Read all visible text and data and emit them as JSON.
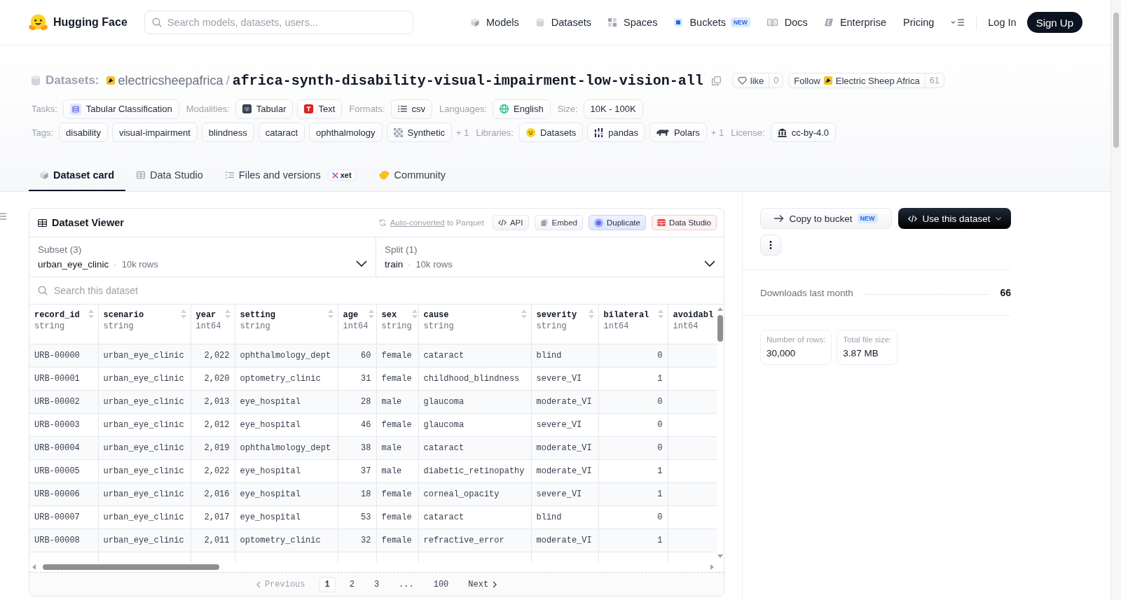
{
  "header": {
    "brand": "Hugging Face",
    "search": {
      "placeholder": "Search models, datasets, users..."
    },
    "nav": [
      {
        "label": "Models"
      },
      {
        "label": "Datasets"
      },
      {
        "label": "Spaces"
      },
      {
        "label": "Buckets",
        "badge": "NEW"
      },
      {
        "label": "Docs"
      },
      {
        "label": "Enterprise"
      },
      {
        "label": "Pricing"
      }
    ],
    "login": "Log In",
    "signup": "Sign Up"
  },
  "repo": {
    "type_label": "Datasets:",
    "owner": "electricsheepafrica",
    "separator": "/",
    "name": "africa-synth-disability-visual-impairment-low-vision-all",
    "like": {
      "label": "like",
      "count": "0"
    },
    "follow": {
      "label": "Follow",
      "org": "Electric Sheep Africa",
      "count": "61"
    }
  },
  "facet_rows": [
    [
      {
        "label": "Tasks:",
        "chips": [
          {
            "text": "Tabular Classification"
          }
        ]
      },
      {
        "label": "Modalities:",
        "chips": [
          {
            "text": "Tabular"
          },
          {
            "text": "Text"
          }
        ]
      },
      {
        "label": "Formats:",
        "chips": [
          {
            "text": "csv"
          }
        ]
      },
      {
        "label": "Languages:",
        "chips": [
          {
            "text": "English"
          }
        ]
      },
      {
        "label": "Size:",
        "chips": [
          {
            "text": "10K - 100K"
          }
        ]
      }
    ],
    [
      {
        "label": "Tags:",
        "chips": [
          {
            "text": "disability"
          },
          {
            "text": "visual-impairment"
          },
          {
            "text": "blindness"
          },
          {
            "text": "cataract"
          },
          {
            "text": "ophthalmology"
          },
          {
            "text": "Synthetic"
          }
        ],
        "more": "+ 1"
      },
      {
        "label": "Libraries:",
        "chips": [
          {
            "text": "Datasets"
          },
          {
            "text": "pandas"
          },
          {
            "text": "Polars"
          }
        ],
        "more": "+ 1"
      },
      {
        "label": "License:",
        "chips": [
          {
            "text": "cc-by-4.0"
          }
        ]
      }
    ]
  ],
  "tabs": [
    {
      "label": "Dataset card",
      "selected": true
    },
    {
      "label": "Data Studio",
      "selected": false
    },
    {
      "label": "Files and versions",
      "selected": false,
      "badge": "xet"
    },
    {
      "label": "Community",
      "selected": false
    }
  ],
  "viewer": {
    "title": "Dataset Viewer",
    "conversion": {
      "link": "Auto-converted",
      "text": "to Parquet"
    },
    "actions": [
      {
        "label": "API",
        "kind": "api"
      },
      {
        "label": "Embed",
        "kind": "embed"
      },
      {
        "label": "Duplicate",
        "kind": "duplicate"
      },
      {
        "label": "Data Studio",
        "kind": "studio"
      }
    ],
    "selectors": [
      {
        "label": "Subset (3)",
        "value": "urban_eye_clinic",
        "separator": "·",
        "count": "10k rows"
      },
      {
        "label": "Split (1)",
        "value": "train",
        "separator": "·",
        "count": "10k rows"
      }
    ],
    "search": {
      "placeholder": "Search this dataset"
    },
    "table": {
      "columns": [
        {
          "name": "record_id",
          "type": "string",
          "kind": "text"
        },
        {
          "name": "scenario",
          "type": "string",
          "kind": "text"
        },
        {
          "name": "year",
          "type": "int64",
          "kind": "number"
        },
        {
          "name": "setting",
          "type": "string",
          "kind": "text"
        },
        {
          "name": "age",
          "type": "int64",
          "kind": "number"
        },
        {
          "name": "sex",
          "type": "string",
          "kind": "text"
        },
        {
          "name": "cause",
          "type": "string",
          "kind": "text"
        },
        {
          "name": "severity",
          "type": "string",
          "kind": "text"
        },
        {
          "name": "bilateral",
          "type": "int64",
          "kind": "number"
        },
        {
          "name": "avoidabl",
          "type": "int64"
        }
      ],
      "rows": [
        [
          "URB-00000",
          "urban_eye_clinic",
          "2,022",
          "ophthalmology_dept",
          "60",
          "female",
          "cataract",
          "blind",
          "0"
        ],
        [
          "URB-00001",
          "urban_eye_clinic",
          "2,020",
          "optometry_clinic",
          "31",
          "female",
          "childhood_blindness",
          "severe_VI",
          "1"
        ],
        [
          "URB-00002",
          "urban_eye_clinic",
          "2,013",
          "eye_hospital",
          "28",
          "male",
          "glaucoma",
          "moderate_VI",
          "0"
        ],
        [
          "URB-00003",
          "urban_eye_clinic",
          "2,012",
          "eye_hospital",
          "46",
          "female",
          "glaucoma",
          "severe_VI",
          "0"
        ],
        [
          "URB-00004",
          "urban_eye_clinic",
          "2,019",
          "ophthalmology_dept",
          "38",
          "male",
          "cataract",
          "moderate_VI",
          "0"
        ],
        [
          "URB-00005",
          "urban_eye_clinic",
          "2,022",
          "eye_hospital",
          "37",
          "male",
          "diabetic_retinopathy",
          "moderate_VI",
          "1"
        ],
        [
          "URB-00006",
          "urban_eye_clinic",
          "2,016",
          "eye_hospital",
          "18",
          "female",
          "corneal_opacity",
          "severe_VI",
          "1"
        ],
        [
          "URB-00007",
          "urban_eye_clinic",
          "2,017",
          "eye_hospital",
          "53",
          "female",
          "cataract",
          "blind",
          "0"
        ],
        [
          "URB-00008",
          "urban_eye_clinic",
          "2,011",
          "optometry_clinic",
          "32",
          "female",
          "refractive_error",
          "moderate_VI",
          "1"
        ]
      ]
    },
    "pagination": {
      "previous": {
        "label": "Previous",
        "disabled": true
      },
      "pages": [
        {
          "label": "1",
          "selected": true
        },
        {
          "label": "2",
          "selected": false
        },
        {
          "label": "3",
          "selected": false
        },
        {
          "label": "...",
          "selected": false
        },
        {
          "label": "100",
          "selected": false
        }
      ],
      "next": {
        "label": "Next",
        "disabled": false
      }
    }
  },
  "sidebar": {
    "copy_button": {
      "label": "Copy to bucket",
      "badge": "NEW"
    },
    "use_button": {
      "label": "Use this dataset"
    },
    "downloads": {
      "label": "Downloads last month",
      "value": "66"
    },
    "stats": [
      {
        "label": "Number of rows:",
        "value": "30,000"
      },
      {
        "label": "Total file size:",
        "value": "3.87 MB"
      }
    ]
  }
}
